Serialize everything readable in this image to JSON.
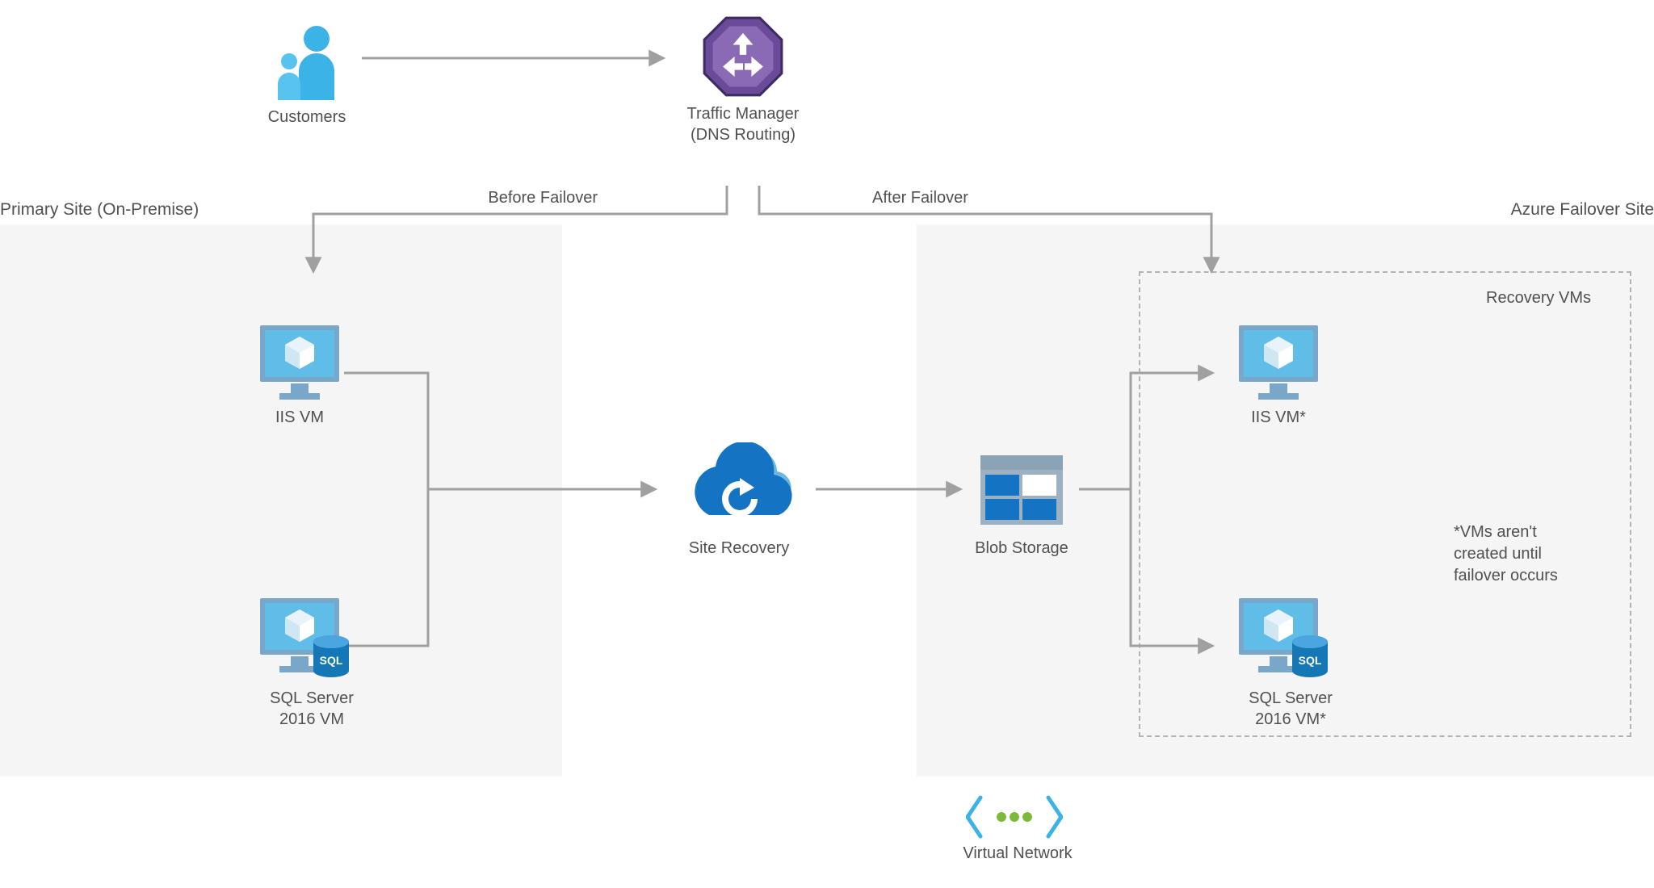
{
  "customers": "Customers",
  "traffic_manager": {
    "title": "Traffic Manager",
    "subtitle": "(DNS Routing)"
  },
  "before_failover": "Before Failover",
  "after_failover": "After Failover",
  "primary_site": "Primary Site (On-Premise)",
  "azure_failover_site": "Azure Failover Site",
  "iis_vm": "IIS VM",
  "sql_vm_l1": "SQL Server",
  "sql_vm_l2": "2016 VM",
  "site_recovery": "Site Recovery",
  "blob_storage": "Blob Storage",
  "recovery_vms": "Recovery VMs",
  "iis_vm_r": "IIS VM*",
  "sql_vm_r_l1": "SQL Server",
  "sql_vm_r_l2": "2016 VM*",
  "note": "*VMs aren't created until failover occurs",
  "virtual_network": "Virtual Network"
}
